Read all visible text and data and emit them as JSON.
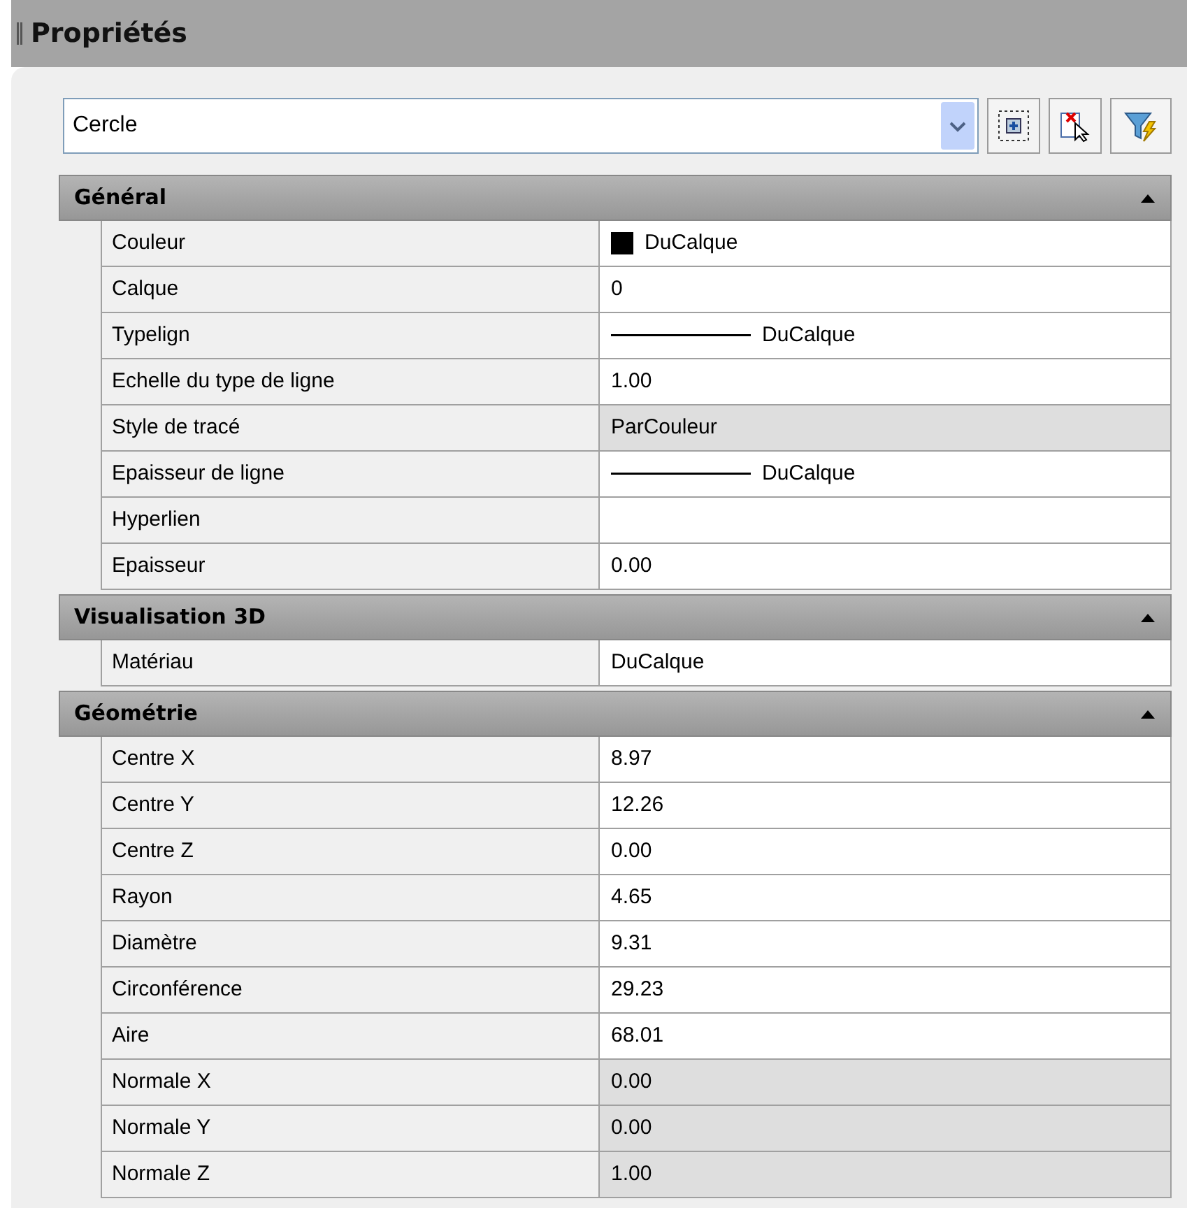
{
  "panel": {
    "title": "Propriétés"
  },
  "selector": {
    "value": "Cercle"
  },
  "sections": [
    {
      "title": "Général",
      "expanded": true,
      "rows": [
        {
          "label": "Couleur",
          "value": "DuCalque",
          "kind": "color",
          "color": "#000000",
          "readonly": false
        },
        {
          "label": "Calque",
          "value": "0",
          "kind": "text",
          "readonly": false
        },
        {
          "label": "Typelign",
          "value": "DuCalque",
          "kind": "line",
          "readonly": false
        },
        {
          "label": "Echelle du type de ligne",
          "value": "1.00",
          "kind": "text",
          "readonly": false
        },
        {
          "label": "Style de tracé",
          "value": "ParCouleur",
          "kind": "text",
          "readonly": true
        },
        {
          "label": "Epaisseur de ligne",
          "value": "DuCalque",
          "kind": "line",
          "readonly": false
        },
        {
          "label": "Hyperlien",
          "kind": "text",
          "readonly": false
        },
        {
          "label": "Epaisseur",
          "value": "0.00",
          "kind": "text",
          "readonly": false
        }
      ]
    },
    {
      "title": "Visualisation 3D",
      "expanded": true,
      "rows": [
        {
          "label": "Matériau",
          "value": "DuCalque",
          "kind": "text",
          "readonly": false
        }
      ]
    },
    {
      "title": "Géométrie",
      "expanded": true,
      "rows": [
        {
          "label": "Centre X",
          "value": "8.97",
          "kind": "text",
          "readonly": false
        },
        {
          "label": "Centre Y",
          "value": "12.26",
          "kind": "text",
          "readonly": false
        },
        {
          "label": "Centre Z",
          "value": "0.00",
          "kind": "text",
          "readonly": false
        },
        {
          "label": "Rayon",
          "value": "4.65",
          "kind": "text",
          "readonly": false
        },
        {
          "label": "Diamètre",
          "value": "9.31",
          "kind": "text",
          "readonly": false
        },
        {
          "label": "Circonférence",
          "value": "29.23",
          "kind": "text",
          "readonly": false
        },
        {
          "label": "Aire",
          "value": "68.01",
          "kind": "text",
          "readonly": false
        },
        {
          "label": "Normale X",
          "value": "0.00",
          "kind": "text",
          "readonly": true
        },
        {
          "label": "Normale Y",
          "value": "0.00",
          "kind": "text",
          "readonly": true
        },
        {
          "label": "Normale Z",
          "value": "1.00",
          "kind": "text",
          "readonly": true
        }
      ]
    }
  ]
}
